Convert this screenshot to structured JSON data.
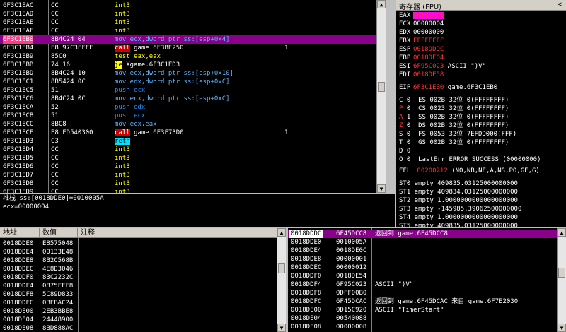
{
  "disasm": {
    "rows": [
      {
        "addr": "6F3C1EAC",
        "hex": "CC",
        "ins": "int3",
        "cls": "k-int",
        "cmt": ""
      },
      {
        "addr": "6F3C1EAD",
        "hex": "CC",
        "ins": "int3",
        "cls": "k-int",
        "cmt": ""
      },
      {
        "addr": "6F3C1EAE",
        "hex": "CC",
        "ins": "int3",
        "cls": "k-int",
        "cmt": ""
      },
      {
        "addr": "6F3C1EAF",
        "hex": "CC",
        "ins": "int3",
        "cls": "k-int",
        "cmt": ""
      },
      {
        "addr": "6F3C1EB0",
        "hex": "8B4C24 04",
        "ins": "mov ecx,dword ptr ss:[esp+0x4]",
        "cls": "k-mov",
        "cmt": "",
        "selected": true
      },
      {
        "addr": "6F3C1EB4",
        "hex": "E8 97C3FFFF",
        "ins": "call",
        "extra": " game.6F3BE250",
        "cls": "k-call",
        "cmt": "1"
      },
      {
        "addr": "6F3C1EB9",
        "hex": "85C0",
        "ins": "test eax,eax",
        "cls": "k-test",
        "cmt": ""
      },
      {
        "addr": "6F3C1EBB",
        "hex": "74 16",
        "ins": "je",
        "extra": " Xgame.6F3C1ED3",
        "cls": "k-je",
        "cmt": ""
      },
      {
        "addr": "6F3C1EBD",
        "hex": "8B4C24 10",
        "ins": "mov ecx,dword ptr ss:[esp+0x10]",
        "cls": "k-mov",
        "cmt": ""
      },
      {
        "addr": "6F3C1EC1",
        "hex": "8B5424 0C",
        "ins": "mov edx,dword ptr ss:[esp+0xC]",
        "cls": "k-mov",
        "cmt": ""
      },
      {
        "addr": "6F3C1EC5",
        "hex": "51",
        "ins": "push ecx",
        "cls": "k-push",
        "cmt": ""
      },
      {
        "addr": "6F3C1EC6",
        "hex": "8B4C24 0C",
        "ins": "mov ecx,dword ptr ss:[esp+0xC]",
        "cls": "k-mov",
        "cmt": ""
      },
      {
        "addr": "6F3C1ECA",
        "hex": "52",
        "ins": "push edx",
        "cls": "k-push",
        "cmt": ""
      },
      {
        "addr": "6F3C1ECB",
        "hex": "51",
        "ins": "push ecx",
        "cls": "k-push",
        "cmt": ""
      },
      {
        "addr": "6F3C1ECC",
        "hex": "8BC8",
        "ins": "mov ecx,eax",
        "cls": "k-mov",
        "cmt": ""
      },
      {
        "addr": "6F3C1ECE",
        "hex": "E8 FD540300",
        "ins": "call",
        "extra": " game.6F3F73D0",
        "cls": "k-call",
        "cmt": "1"
      },
      {
        "addr": "6F3C1ED3",
        "hex": "C3",
        "ins": "retn",
        "cls": "k-retn",
        "cmt": ""
      },
      {
        "addr": "6F3C1ED4",
        "hex": "CC",
        "ins": "int3",
        "cls": "k-int",
        "cmt": ""
      },
      {
        "addr": "6F3C1ED5",
        "hex": "CC",
        "ins": "int3",
        "cls": "k-int",
        "cmt": ""
      },
      {
        "addr": "6F3C1ED6",
        "hex": "CC",
        "ins": "int3",
        "cls": "k-int",
        "cmt": ""
      },
      {
        "addr": "6F3C1ED7",
        "hex": "CC",
        "ins": "int3",
        "cls": "k-int",
        "cmt": ""
      },
      {
        "addr": "6F3C1ED8",
        "hex": "CC",
        "ins": "int3",
        "cls": "k-int",
        "cmt": ""
      },
      {
        "addr": "6F3C1ED9",
        "hex": "CC",
        "ins": "int3",
        "cls": "k-int",
        "cmt": ""
      }
    ]
  },
  "info": {
    "line1": "堆栈 ss:[0018DDE0]=0010005A",
    "line2": "ecx=00000004"
  },
  "registers": {
    "title": "寄存器 (FPU)",
    "collapse": "<",
    "gp": [
      {
        "name": "EAX",
        "value": "0018DDE0",
        "hl": "magenta"
      },
      {
        "name": "ECX",
        "value": "00000004"
      },
      {
        "name": "EDX",
        "value": "00000000"
      },
      {
        "name": "EBX",
        "value": "FFFFFFFF",
        "red": true
      },
      {
        "name": "ESP",
        "value": "0018DDDC",
        "red": true
      },
      {
        "name": "EBP",
        "value": "0018DE04",
        "red": true
      },
      {
        "name": "ESI",
        "value": "6F95C023",
        "red": true,
        "extra": "ASCII \")V\""
      },
      {
        "name": "EDI",
        "value": "0018DE58",
        "red": true
      }
    ],
    "eip": {
      "name": "EIP",
      "value": "6F3C1EB0",
      "extra": "game.6F3C1EB0"
    },
    "flags": [
      "C 0  ES 002B 32位 0(FFFFFFFF)",
      "P 0  CS 0023 32位 0(FFFFFFFF)",
      "A 1  SS 002B 32位 0(FFFFFFFF)",
      "Z 0  DS 002B 32位 0(FFFFFFFF)",
      "S 0  FS 0053 32位 7EFDD000(FFF)",
      "T 0  GS 002B 32位 0(FFFFFFFF)",
      "D 0",
      "O 0  LastErr ERROR_SUCCESS (00000000)"
    ],
    "flag_red_letters": [
      "P",
      "A",
      "Z"
    ],
    "efl": {
      "name": "EFL",
      "value": "00200212",
      "extra": "(NO,NB,NE,A,NS,PO,GE,G)"
    },
    "st": [
      "ST0 empty 409835.03125000000000",
      "ST1 empty 409834.03125000000000",
      "ST2 empty 1.0000000000000000000",
      "ST3 empty -145985.39062500000000",
      "ST4 empty 1.0000000000000000000",
      "ST5 empty 409835.03125000000000"
    ]
  },
  "dump": {
    "headers": [
      "地址",
      "数值",
      "注释"
    ],
    "rows": [
      {
        "addr": "0018DDE0",
        "val": "E8575048"
      },
      {
        "addr": "0018DDE4",
        "val": "00133E48"
      },
      {
        "addr": "0018DDE8",
        "val": "8B2C568B"
      },
      {
        "addr": "0018DDEC",
        "val": "4E8D3046"
      },
      {
        "addr": "0018DDF0",
        "val": "83C2232C"
      },
      {
        "addr": "0018DDF4",
        "val": "0875FFF8"
      },
      {
        "addr": "0018DDF8",
        "val": "5C89D833"
      },
      {
        "addr": "0018DDFC",
        "val": "0BEBAC24"
      },
      {
        "addr": "0018DE00",
        "val": "2EB3BBE8"
      },
      {
        "addr": "0018DE04",
        "val": "24448900"
      },
      {
        "addr": "0018DE08",
        "val": "8BD888AC"
      }
    ]
  },
  "stack": {
    "rows": [
      {
        "addr": "0018DDDC",
        "val": "6F45DCC8",
        "cmt": "返回到 game.6F45DCC8",
        "selected": true
      },
      {
        "addr": "0018DDE0",
        "val": "0010005A",
        "cmt": ""
      },
      {
        "addr": "0018DDE4",
        "val": "0018DE0C",
        "cmt": ""
      },
      {
        "addr": "0018DDE8",
        "val": "00000001",
        "cmt": ""
      },
      {
        "addr": "0018DDEC",
        "val": "00000012",
        "cmt": ""
      },
      {
        "addr": "0018DDF0",
        "val": "0018DE54",
        "cmt": ""
      },
      {
        "addr": "0018DDF4",
        "val": "6F95C023",
        "cmt": "ASCII \")V\""
      },
      {
        "addr": "0018DDF8",
        "val": "0DFF00B0",
        "cmt": ""
      },
      {
        "addr": "0018DDFC",
        "val": "6F45DCAC",
        "cmt": "返回到 game.6F45DCAC 来自 game.6F7E2030"
      },
      {
        "addr": "0018DE00",
        "val": "0D15C920",
        "cmt": "ASCII \"TimerStart\""
      },
      {
        "addr": "0018DE04",
        "val": "00540088",
        "cmt": ""
      },
      {
        "addr": "0018DE08",
        "val": "00000008",
        "cmt": ""
      }
    ]
  },
  "colors": {
    "accent": "#8b008b",
    "bg": "#000000"
  }
}
